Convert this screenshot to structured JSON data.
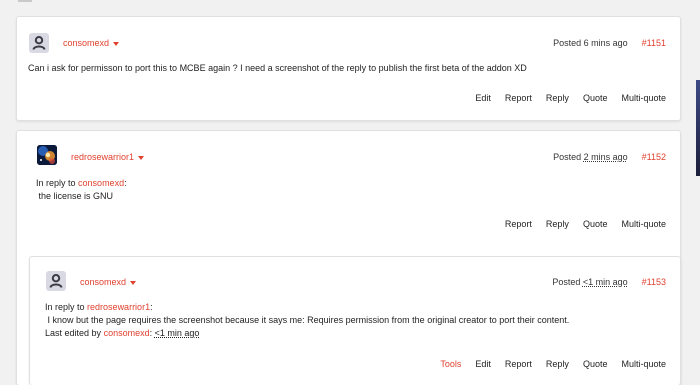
{
  "posts": [
    {
      "username": "consomexd",
      "posted_prefix": "Posted",
      "posted_time": "6 mins ago",
      "post_number": "#1151",
      "text": "Can i ask for permisson to port this to MCBE again ? I need a screenshot of the reply to publish the first beta of the addon XD",
      "actions": [
        "Edit",
        "Report",
        "Reply",
        "Quote",
        "Multi-quote"
      ]
    },
    {
      "username": "redrosewarrior1",
      "posted_prefix": "Posted",
      "posted_time": "2 mins ago",
      "post_number": "#1152",
      "reply_prefix": "In reply to",
      "reply_to": "consomexd",
      "reply_suffix": ":",
      "text": " the license is GNU",
      "actions": [
        "Report",
        "Reply",
        "Quote",
        "Multi-quote"
      ]
    },
    {
      "username": "consomexd",
      "posted_prefix": "Posted",
      "posted_time": "<1 min ago",
      "post_number": "#1153",
      "reply_prefix": "In reply to",
      "reply_to": "redrosewarrior1",
      "reply_suffix": ":",
      "text": " I know but the page requires the screenshot because it says me: Requires permission from the original creator to port their content.",
      "edited_prefix": "Last edited by",
      "edited_by": "consomexd",
      "edited_sep": ":",
      "edited_time": "<1 min ago",
      "actions": [
        "Tools",
        "Edit",
        "Report",
        "Reply",
        "Quote",
        "Multi-quote"
      ]
    }
  ],
  "colors": {
    "accent": "#e0412f",
    "background": "#f1f1f2",
    "card": "#ffffff"
  },
  "icons": {
    "default_avatar": "user-silhouette-icon",
    "dropdown": "caret-down-icon",
    "custom_avatar": "space-nebula-avatar"
  }
}
